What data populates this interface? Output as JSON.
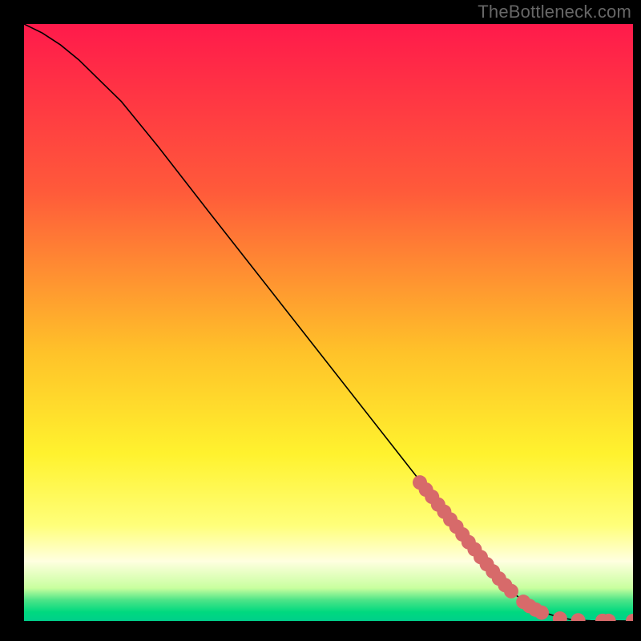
{
  "watermark": "TheBottleneck.com",
  "chart_data": {
    "type": "line",
    "title": "",
    "xlabel": "",
    "ylabel": "",
    "xlim": [
      0,
      100
    ],
    "ylim": [
      0,
      100
    ],
    "gradient_stops": [
      {
        "offset": 0.0,
        "color": "#ff1a4b"
      },
      {
        "offset": 0.28,
        "color": "#ff5a3a"
      },
      {
        "offset": 0.55,
        "color": "#ffc229"
      },
      {
        "offset": 0.72,
        "color": "#fff22e"
      },
      {
        "offset": 0.84,
        "color": "#ffff7a"
      },
      {
        "offset": 0.9,
        "color": "#ffffe0"
      },
      {
        "offset": 0.945,
        "color": "#c8ff9e"
      },
      {
        "offset": 0.965,
        "color": "#4de488"
      },
      {
        "offset": 0.985,
        "color": "#00d97f"
      },
      {
        "offset": 1.0,
        "color": "#00cf8a"
      }
    ],
    "curve": {
      "x": [
        0,
        3,
        6,
        9,
        12,
        16,
        22,
        30,
        40,
        50,
        60,
        70,
        76,
        80,
        83,
        86,
        88,
        90,
        93,
        100
      ],
      "y": [
        100,
        98.5,
        96.5,
        94,
        91,
        87,
        79.5,
        69,
        56,
        43,
        30,
        17,
        9.5,
        5,
        2.5,
        1.2,
        0.6,
        0.2,
        0.05,
        0.0
      ]
    },
    "series": [
      {
        "name": "dots",
        "marker_color": "#d76a6a",
        "marker_radius_px": 9,
        "x": [
          65,
          66,
          67,
          68,
          69,
          70,
          71,
          72,
          73,
          74,
          75,
          76,
          77,
          78,
          79,
          80,
          82,
          83,
          84,
          85,
          88,
          91,
          95,
          96,
          100
        ],
        "y": [
          23.2,
          22.0,
          20.8,
          19.5,
          18.3,
          17.0,
          15.8,
          14.5,
          13.2,
          12.0,
          10.7,
          9.5,
          8.3,
          7.1,
          6.0,
          5.0,
          3.2,
          2.5,
          1.9,
          1.4,
          0.4,
          0.1,
          0.02,
          0.015,
          0.0
        ]
      }
    ]
  }
}
